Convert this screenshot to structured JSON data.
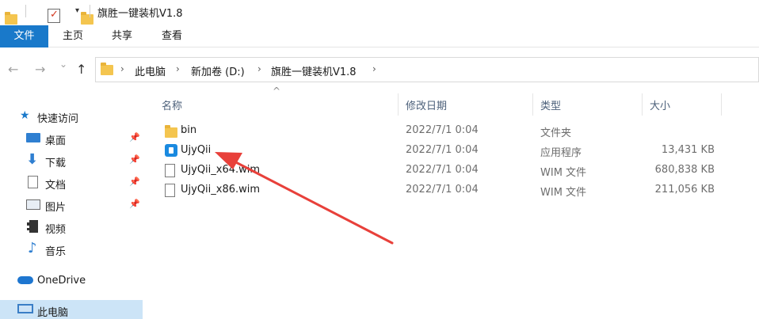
{
  "window": {
    "title": "旗胜一键装机V1.8",
    "quick_access_dropdown": "▾"
  },
  "ribbon": {
    "tabs": [
      {
        "label": "文件",
        "active": true
      },
      {
        "label": "主页"
      },
      {
        "label": "共享"
      },
      {
        "label": "查看"
      }
    ]
  },
  "navigation": {
    "back": "←",
    "forward": "→",
    "recent": "⌄",
    "up": "↑"
  },
  "address": {
    "breadcrumbs": [
      "此电脑",
      "新加卷 (D:)",
      "旗胜一键装机V1.8"
    ],
    "separator": "›"
  },
  "sidebar": {
    "quick_access": {
      "label": "快速访问"
    },
    "items": [
      {
        "label": "桌面",
        "icon": "desktop-icon",
        "pinned": true
      },
      {
        "label": "下载",
        "icon": "download-icon",
        "pinned": true
      },
      {
        "label": "文档",
        "icon": "document-icon",
        "pinned": true
      },
      {
        "label": "图片",
        "icon": "pictures-icon",
        "pinned": true
      },
      {
        "label": "视频",
        "icon": "video-icon"
      },
      {
        "label": "音乐",
        "icon": "music-icon"
      }
    ],
    "onedrive": {
      "label": "OneDrive"
    },
    "this_pc": {
      "label": "此电脑",
      "selected": true
    }
  },
  "file_list": {
    "columns": [
      {
        "label": "名称"
      },
      {
        "label": "修改日期"
      },
      {
        "label": "类型"
      },
      {
        "label": "大小"
      }
    ],
    "sort_indicator": "^",
    "rows": [
      {
        "name": "bin",
        "date": "2022/7/1 0:04",
        "type": "文件夹",
        "size": "",
        "icon": "folder-icon"
      },
      {
        "name": "UjyQii",
        "date": "2022/7/1 0:04",
        "type": "应用程序",
        "size": "13,431 KB",
        "icon": "app-icon"
      },
      {
        "name": "UjyQii_x64.wim",
        "date": "2022/7/1 0:04",
        "type": "WIM 文件",
        "size": "680,838 KB",
        "icon": "file-icon"
      },
      {
        "name": "UjyQii_x86.wim",
        "date": "2022/7/1 0:04",
        "type": "WIM 文件",
        "size": "211,056 KB",
        "icon": "file-icon"
      }
    ]
  },
  "annotation": {
    "color": "#e8403a"
  }
}
